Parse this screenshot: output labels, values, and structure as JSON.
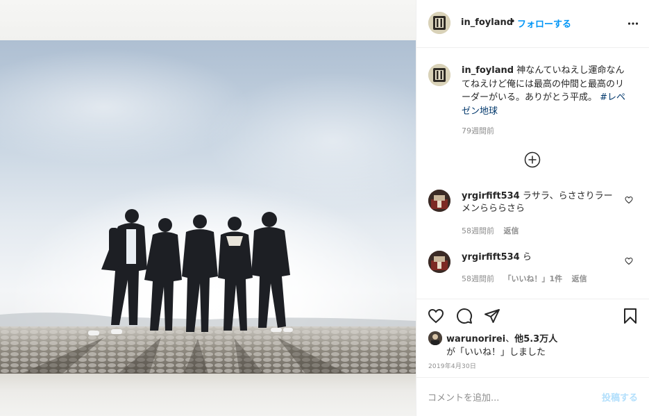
{
  "post": {
    "username": "in_foyland",
    "separator": "•",
    "follow_label": "フォローする",
    "caption_username": "in_foyland",
    "caption_text": "神なんていねえし運命なんてねえけど俺には最高の仲間と最高のリーダーがいる。ありがとう平成。",
    "caption_hashtag": "#レペゼン地球",
    "caption_time": "79週間前",
    "photo_description_icon": "group-photo"
  },
  "comments": [
    {
      "username": "yrgirfift534",
      "text": "ラサラ、らささりラーメンらららさら",
      "time": "58週間前",
      "likes": "",
      "reply": "返信"
    },
    {
      "username": "yrgirfift534",
      "text": "ら",
      "time": "58週間前",
      "likes": "「いいね！」1件",
      "reply": "返信"
    }
  ],
  "likes": {
    "liker": "warunorirei",
    "joiner": "、",
    "others": "他5.3万人",
    "suffix": "が「いいね！」しました"
  },
  "date": "2019年4月30日",
  "add_comment": {
    "placeholder": "コメントを追加...",
    "post_label": "投稿する"
  },
  "colors": {
    "accent": "#0095f6",
    "post_disabled": "#b2dffc",
    "hashtag": "#00376b",
    "meta": "#8e8e8e"
  }
}
